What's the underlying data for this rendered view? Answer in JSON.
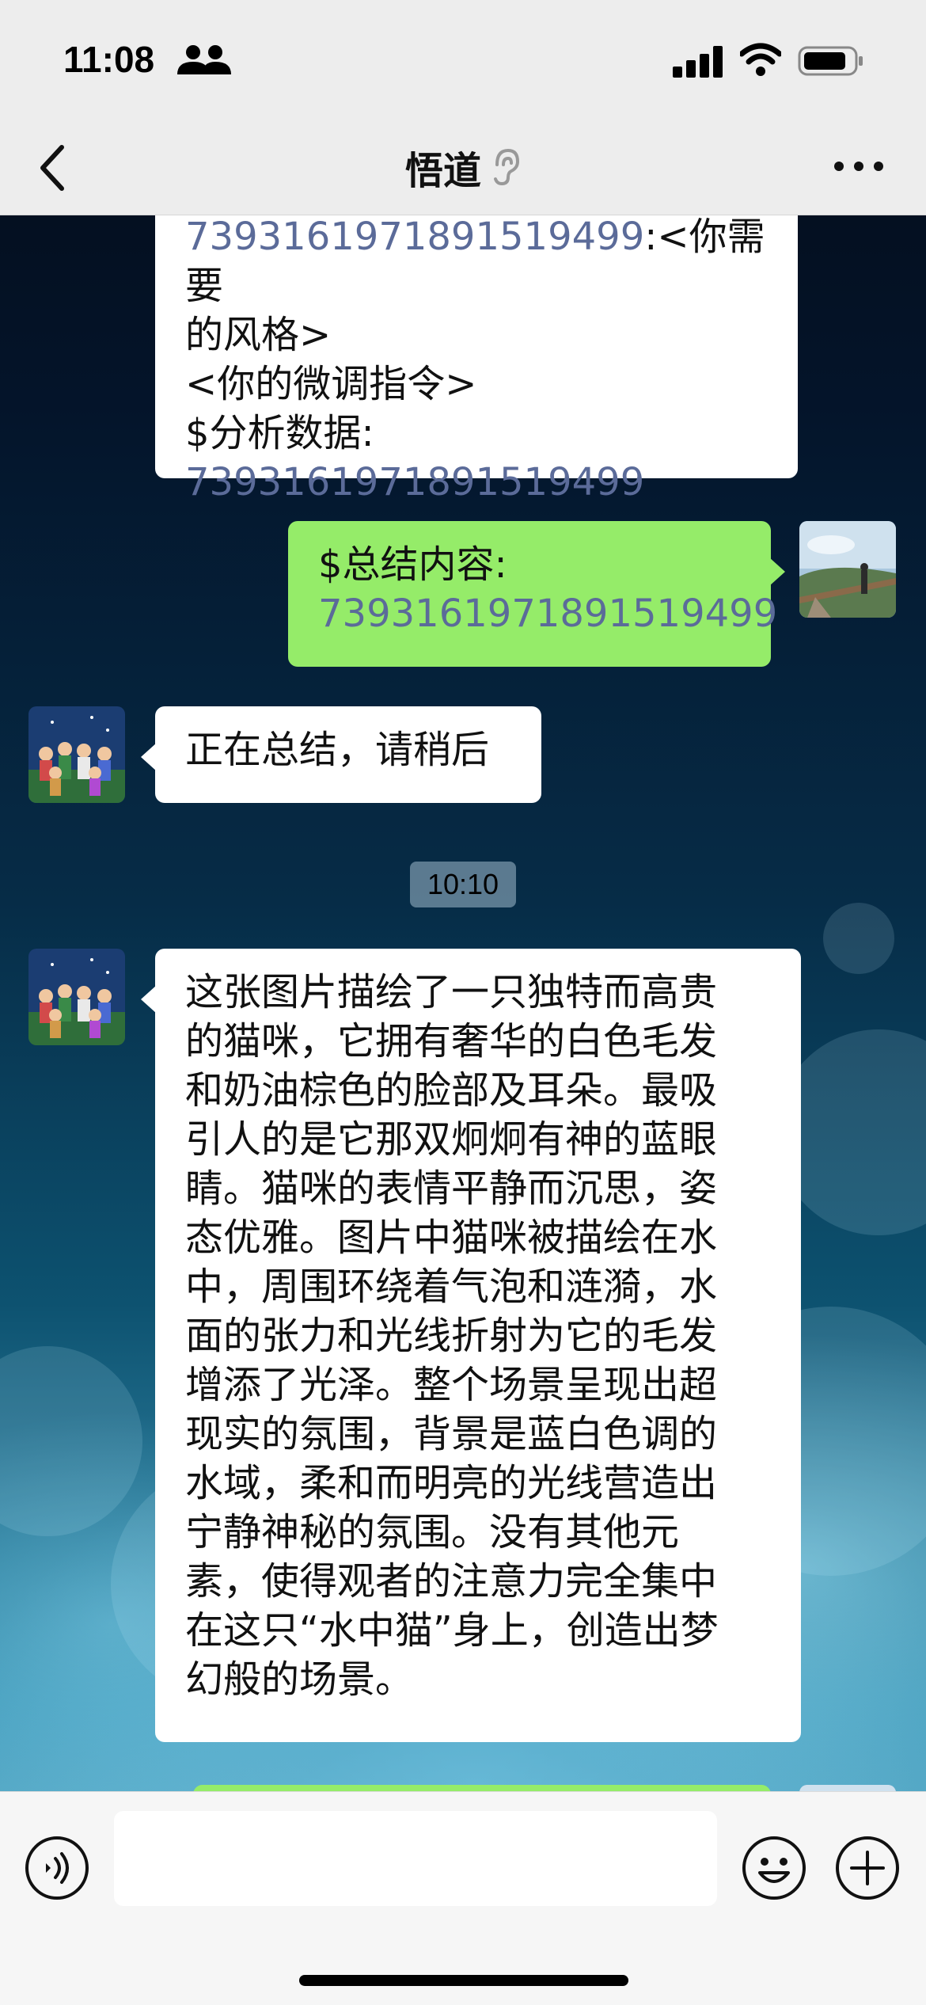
{
  "status_bar": {
    "time": "11:08"
  },
  "header": {
    "title": "悟道"
  },
  "messages": [
    {
      "side": "left",
      "lines": [
        {
          "text": "7393161971891519499",
          "link": true,
          "suffix": ":<你需要"
        },
        {
          "text": "的风格>"
        },
        {
          "text": "<你的微调指令>"
        },
        {
          "text": "$分析数据:"
        },
        {
          "text": "7393161971891519499",
          "link": true
        }
      ]
    },
    {
      "side": "right",
      "lines": [
        {
          "text": "$总结内容:"
        },
        {
          "text": "7393161971891519499",
          "link": true
        }
      ]
    },
    {
      "side": "left",
      "lines": [
        {
          "text": "正在总结，请稍后"
        }
      ]
    },
    {
      "timestamp": "10:10"
    },
    {
      "side": "left",
      "lines": [
        {
          "text": "这张图片描绘了一只独特而高贵"
        },
        {
          "text": "的猫咪，它拥有奢华的白色毛发"
        },
        {
          "text": "和奶油棕色的脸部及耳朵。最吸"
        },
        {
          "text": "引人的是它那双炯炯有神的蓝眼"
        },
        {
          "text": "睛。猫咪的表情平静而沉思，姿"
        },
        {
          "text": "态优雅。图片中猫咪被描绘在水"
        },
        {
          "text": "中，周围环绕着气泡和涟漪，水"
        },
        {
          "text": "面的张力和光线折射为它的毛发"
        },
        {
          "text": "增添了光泽。整个场景呈现出超"
        },
        {
          "text": "现实的氛围，背景是蓝白色调的"
        },
        {
          "text": "水域，柔和而明亮的光线营造出"
        },
        {
          "text": "宁静神秘的氛围。没有其他元"
        },
        {
          "text": "素，使得观者的注意力完全集中"
        },
        {
          "text": "在这只“水中猫”身上，创造出梦"
        },
        {
          "text": "幻般的场景。"
        }
      ]
    }
  ],
  "input": {
    "placeholder": ""
  },
  "colors": {
    "bubble_green": "#95ec69",
    "link": "#5b6b99",
    "bar_bg": "#ededed"
  },
  "icons": [
    "people-icon",
    "signal-icon",
    "wifi-icon",
    "battery-icon",
    "back-icon",
    "ear-icon",
    "more-icon",
    "voice-icon",
    "emoji-icon",
    "plus-icon"
  ]
}
